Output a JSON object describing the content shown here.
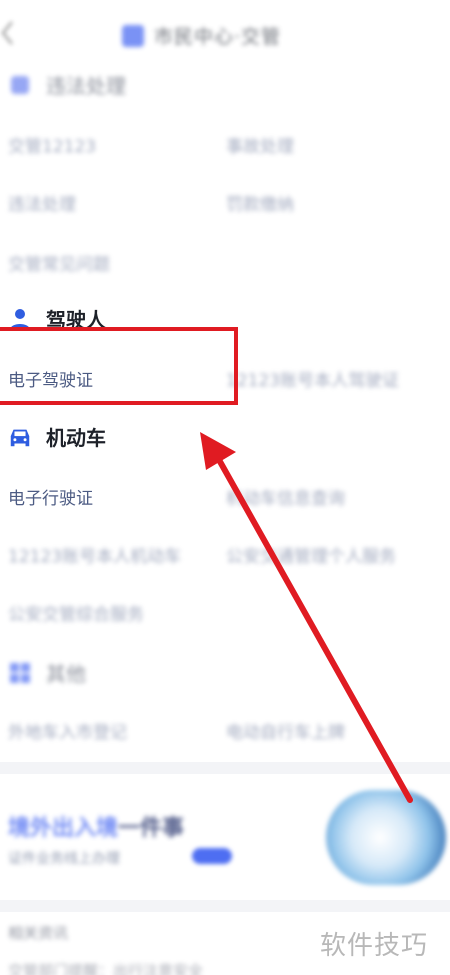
{
  "header": {
    "title": "市民中心·交管"
  },
  "sections": {
    "traffic": {
      "title": "违法处理",
      "items": [
        "交管12123",
        "事故处理",
        "违法处理",
        "罚款缴纳",
        "交管常见问题"
      ]
    },
    "driver": {
      "title": "驾驶人",
      "items": [
        "电子驾驶证",
        "12123账号本人驾驶证"
      ]
    },
    "vehicle": {
      "title": "机动车",
      "items": [
        "电子行驶证",
        "机动车信息查询",
        "12123账号本人机动车",
        "公安交通管理个人服务",
        "公安交管综合服务"
      ]
    },
    "other": {
      "title": "其他",
      "items": [
        "外地车入市登记",
        "电动自行车上牌"
      ]
    }
  },
  "banner": {
    "title_accent": "境外出入境",
    "title_rest": "一件事",
    "subtitle": "证件业务线上办理"
  },
  "news": {
    "label": "相关资讯",
    "first_item": "交管部门提醒：出行注意安全"
  },
  "watermark": "软件技巧",
  "colors": {
    "accent_blue": "#4e6ef2",
    "highlight_red": "#e01b22",
    "link_text": "#4c5b83"
  }
}
